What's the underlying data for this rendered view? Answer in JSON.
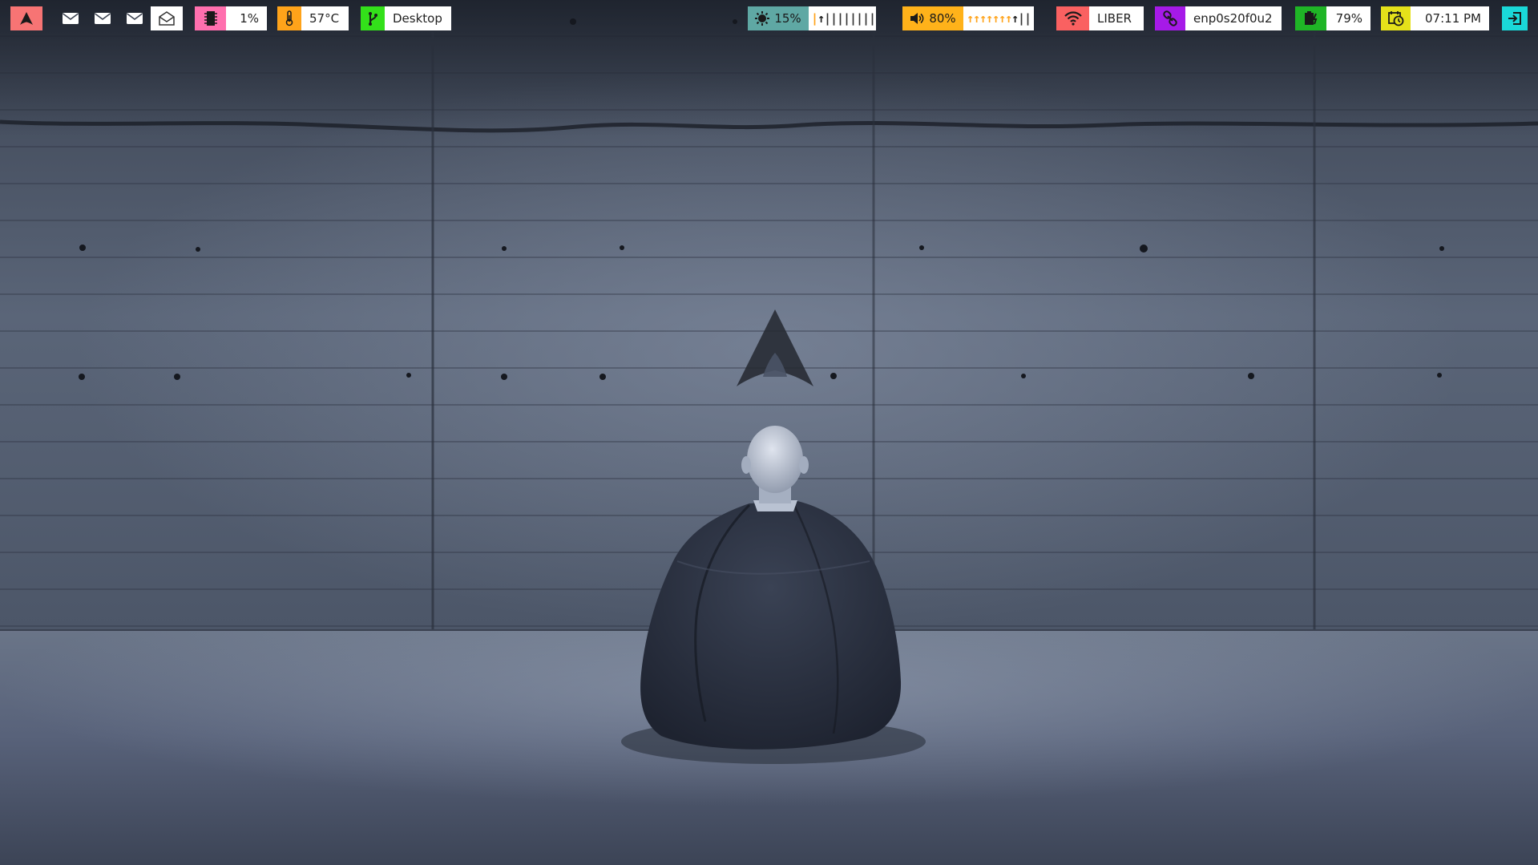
{
  "colors": {
    "arch": "#f77474",
    "memory": "#ff6fae",
    "temperature": "#ffa31a",
    "workspace": "#33e01a",
    "brightness": "#5fa8a4",
    "volume": "#ffb21a",
    "wifi": "#fa6161",
    "network": "#a61ae8",
    "battery": "#1fb526",
    "clock": "#e5e11a",
    "power": "#1ad8d8",
    "bar_text": "#222222",
    "bar_filled": "#ffa31a",
    "bar_empty": "#333333"
  },
  "bar": {
    "launcher": {
      "icon": "arch-logo-icon"
    },
    "mail": [
      {
        "icon": "mail-icon"
      },
      {
        "icon": "mail-icon"
      },
      {
        "icon": "mail-icon"
      },
      {
        "icon": "mail-open-icon"
      }
    ],
    "memory": {
      "icon": "memory-icon",
      "value": "1%"
    },
    "temperature": {
      "icon": "thermometer-icon",
      "value": "57°C"
    },
    "workspace": {
      "icon": "workspace-icon",
      "value": "Desktop"
    },
    "brightness": {
      "icon": "brightness-icon",
      "value": "15%",
      "level": 0.15,
      "bar_text": "||||||||||"
    },
    "volume": {
      "icon": "volume-icon",
      "value": "80%",
      "level": 0.8,
      "bar_text": "||||||||||"
    },
    "wifi": {
      "icon": "wifi-icon",
      "value": "LIBER"
    },
    "network": {
      "icon": "link-icon",
      "value": "enp0s20f0u2"
    },
    "battery": {
      "icon": "battery-charging-icon",
      "value": "79%"
    },
    "clock": {
      "icon": "calendar-clock-icon",
      "value": "07:11 PM"
    },
    "power": {
      "icon": "logout-icon"
    }
  }
}
